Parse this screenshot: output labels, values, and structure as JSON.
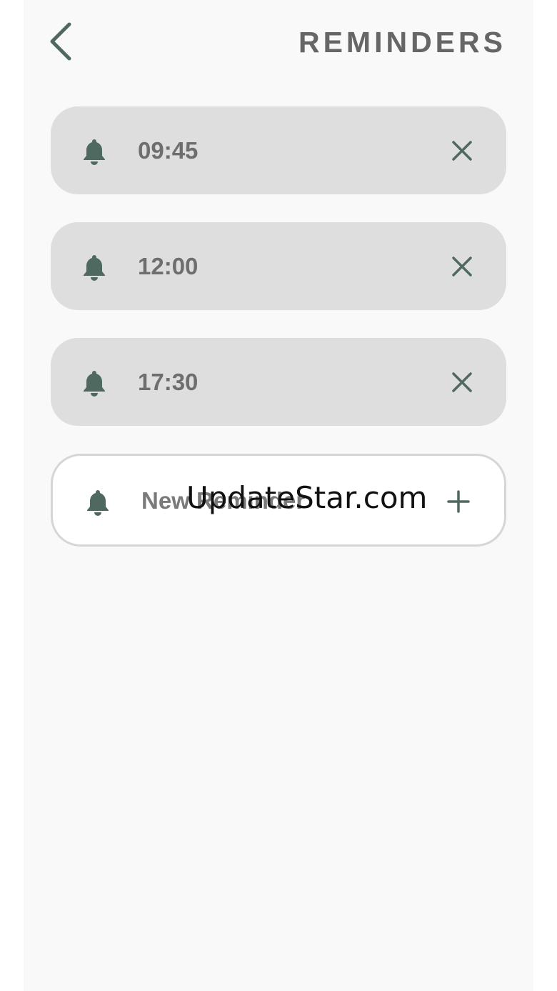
{
  "header": {
    "title": "REMINDERS",
    "back_icon": "chevron-left-icon"
  },
  "colors": {
    "accent": "#4f6860",
    "card_bg": "#dedede",
    "text_muted": "#6e6e6e",
    "screen_bg": "#f9f9f9"
  },
  "reminders": [
    {
      "time": "09:45",
      "icon": "bell-icon",
      "action_icon": "close-icon"
    },
    {
      "time": "12:00",
      "icon": "bell-icon",
      "action_icon": "close-icon"
    },
    {
      "time": "17:30",
      "icon": "bell-icon",
      "action_icon": "close-icon"
    }
  ],
  "new_reminder": {
    "placeholder": "New Reminder",
    "value": "",
    "icon": "bell-icon",
    "action_icon": "plus-icon"
  },
  "watermark": "UpdateStar.com"
}
